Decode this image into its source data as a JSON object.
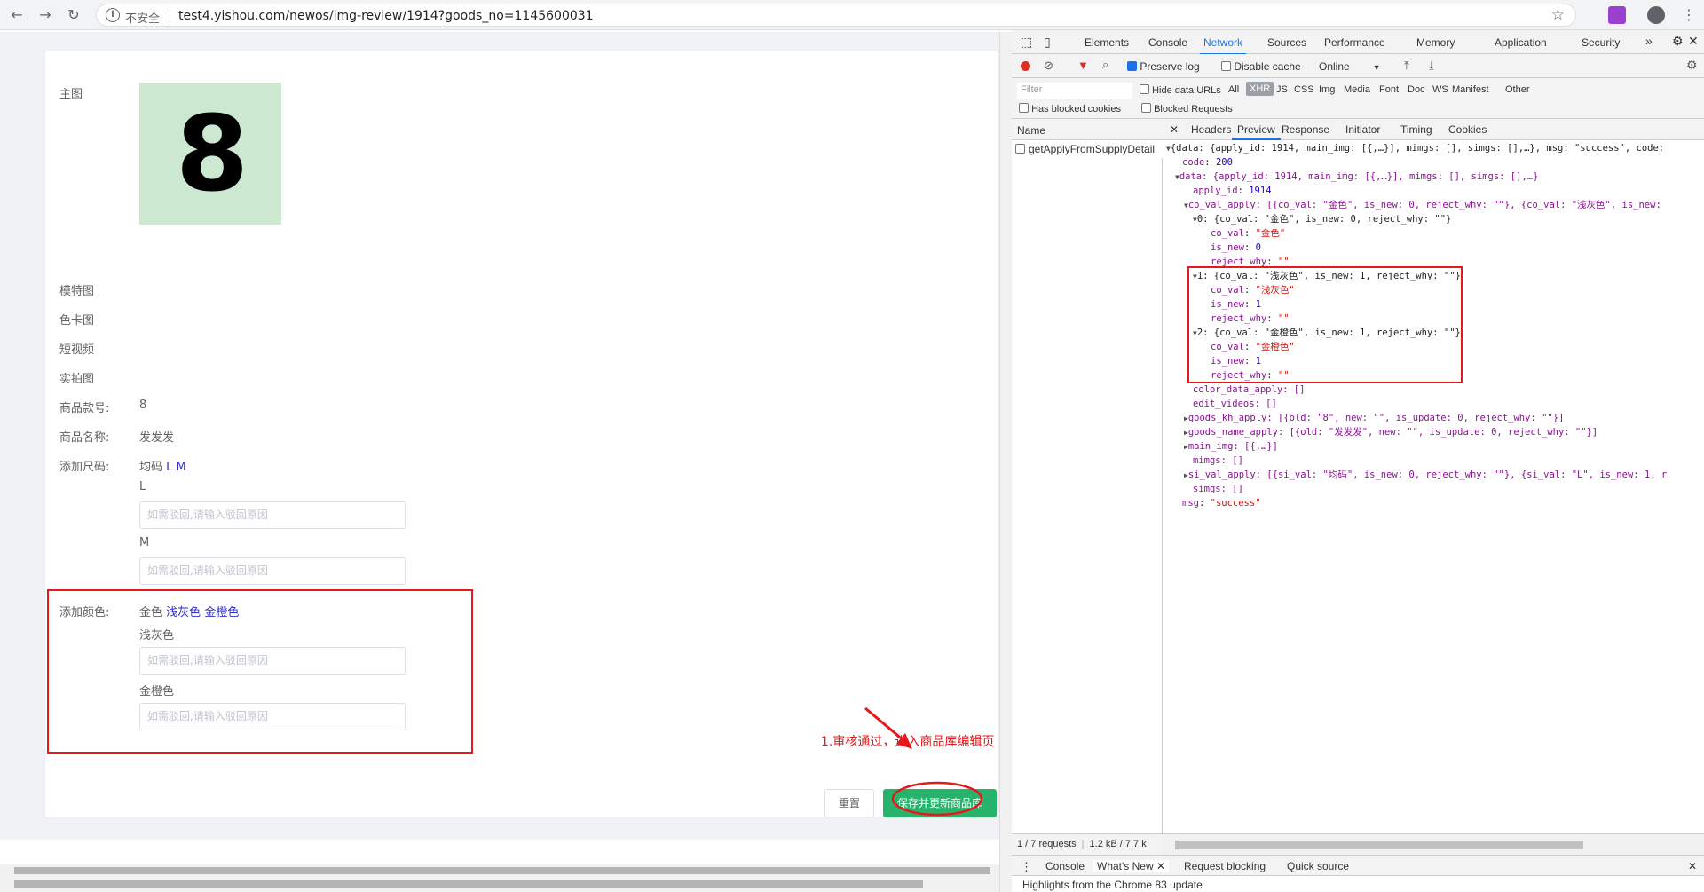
{
  "browser": {
    "insecure_label": "不安全",
    "url": "test4.yishou.com/newos/img-review/1914?goods_no=1145600031"
  },
  "form": {
    "main_image_label": "主图",
    "main_image_glyph": "8",
    "model_image_label": "模特图",
    "color_card_label": "色卡图",
    "short_video_label": "短视频",
    "real_shot_label": "实拍图",
    "goods_no_label": "商品款号:",
    "goods_no_value": "8",
    "goods_name_label": "商品名称:",
    "goods_name_value": "发发发",
    "add_size_label": "添加尺码:",
    "sizes": {
      "existing": "均码",
      "new1": "L",
      "new2": "M"
    },
    "size_L_title": "L",
    "size_M_title": "M",
    "reject_placeholder": "如需驳回,请输入驳回原因",
    "add_color_label": "添加颜色:",
    "colors": {
      "existing": "金色",
      "new1": "浅灰色",
      "new2": "金橙色"
    },
    "color1_title": "浅灰色",
    "color2_title": "金橙色",
    "reset_button": "重置",
    "save_button": "保存并更新商品库",
    "annotation": "1.审核通过，进入商品库编辑页"
  },
  "devtools": {
    "tabs": [
      "Elements",
      "Console",
      "Network",
      "Sources",
      "Performance",
      "Memory",
      "Application",
      "Security"
    ],
    "active_tab": "Network",
    "preserve_log": "Preserve log",
    "disable_cache": "Disable cache",
    "throttle": "Online",
    "filter_placeholder": "Filter",
    "hide_data_urls": "Hide data URLs",
    "types": [
      "All",
      "XHR",
      "JS",
      "CSS",
      "Img",
      "Media",
      "Font",
      "Doc",
      "WS",
      "Manifest",
      "Other"
    ],
    "has_blocked_cookies": "Has blocked cookies",
    "blocked_requests": "Blocked Requests",
    "name_header": "Name",
    "request_name": "getApplyFromSupplyDetail",
    "footer_status": "1 / 7 requests",
    "footer_size": "1.2 kB / 7.7 k",
    "detail_tabs": [
      "Headers",
      "Preview",
      "Response",
      "Initiator",
      "Timing",
      "Cookies"
    ],
    "drawer_tabs": [
      "Console",
      "What's New",
      "Request blocking",
      "Quick source"
    ],
    "drawer_text": "Highlights from the Chrome 83 update"
  },
  "json_preview": {
    "l1": "{data: {apply_id: 1914, main_img: [{,…}], mimgs: [], simgs: [],…}, msg: \"success\", code:",
    "code_key": "code",
    "code_val": "200",
    "data_summary": "data: {apply_id: 1914, main_img: [{,…}], mimgs: [], simgs: [],…}",
    "apply_id_key": "apply_id",
    "apply_id_val": "1914",
    "co_val_apply_summary": "co_val_apply: [{co_val: \"金色\", is_new: 0, reject_why: \"\"}, {co_val: \"浅灰色\", is_new:",
    "i0_summary": "0: {co_val: \"金色\", is_new: 0, reject_why: \"\"}",
    "i0_co_val": "\"金色\"",
    "i0_is_new": "0",
    "i0_reject": "\"\"",
    "i1_summary": "1: {co_val: \"浅灰色\", is_new: 1, reject_why: \"\"}",
    "i1_co_val": "\"浅灰色\"",
    "i1_is_new": "1",
    "i1_reject": "\"\"",
    "i2_summary": "2: {co_val: \"金橙色\", is_new: 1, reject_why: \"\"}",
    "i2_co_val": "\"金橙色\"",
    "i2_is_new": "1",
    "i2_reject": "\"\"",
    "color_data_apply": "color_data_apply: []",
    "edit_videos": "edit_videos: []",
    "goods_kh_apply": "goods_kh_apply: [{old: \"8\", new: \"\", is_update: 0, reject_why: \"\"}]",
    "goods_name_apply": "goods_name_apply: [{old: \"发发发\", new: \"\", is_update: 0, reject_why: \"\"}]",
    "main_img": "main_img: [{,…}]",
    "mimgs": "mimgs: []",
    "si_val_apply": "si_val_apply: [{si_val: \"均码\", is_new: 0, reject_why: \"\"}, {si_val: \"L\", is_new: 1, r",
    "simgs": "simgs: []",
    "msg_key": "msg",
    "msg_val": "\"success\""
  },
  "colors": {
    "accent_red": "#e5191d",
    "save_green": "#26b36b",
    "link_blue": "#2f2fd6",
    "devtools_blue": "#1a73e8"
  }
}
